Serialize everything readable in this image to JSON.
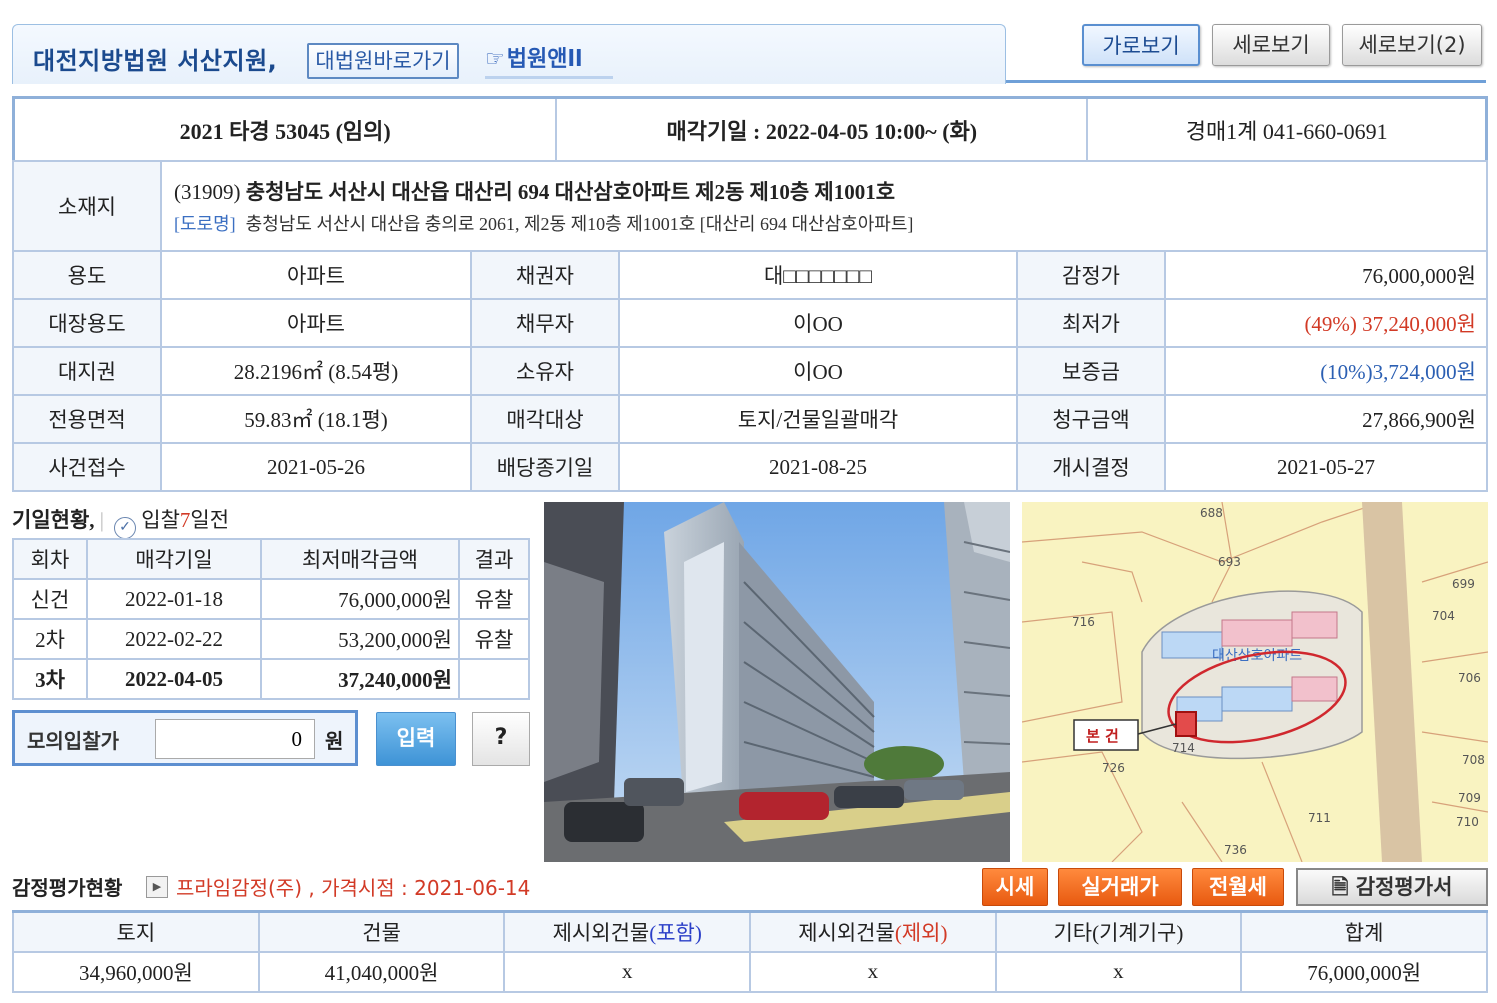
{
  "header": {
    "court_name": "대전지방법원 서산지원,",
    "court_link": "대법원바로가기",
    "court_ani": "법원앤ll",
    "view_landscape": "가로보기",
    "view_portrait": "세로보기",
    "view_portrait2": "세로보기(2)"
  },
  "case": {
    "number": "2021 타경 53045 (임의)",
    "sale_date": "매각기일 : 2022-04-05 10:00~ (화)",
    "dept": "경매1계 041-660-0691"
  },
  "address": {
    "label": "소재지",
    "zip": "(31909)",
    "main": "충청남도 서산시 대산읍 대산리 694 대산삼호아파트 제2동 제10층 제1001호",
    "road_tag": "[도로명]",
    "road": "충청남도 서산시 대산읍 충의로 2061, 제2동 제10층 제1001호 [대산리 694 대산삼호아파트]"
  },
  "info": {
    "use_label": "용도",
    "use": "아파트",
    "creditor_label": "채권자",
    "creditor": "대□□□□□□□",
    "appraisal_label": "감정가",
    "appraisal": "76,000,000원",
    "ledger_label": "대장용도",
    "ledger": "아파트",
    "debtor_label": "채무자",
    "debtor": "이OO",
    "min_label": "최저가",
    "min_price": "(49%) 37,240,000원",
    "land_label": "대지권",
    "land": "28.2196㎡ (8.54평)",
    "owner_label": "소유자",
    "owner": "이OO",
    "deposit_label": "보증금",
    "deposit": "(10%)3,724,000원",
    "area_label": "전용면적",
    "area": "59.83㎡ (18.1평)",
    "target_label": "매각대상",
    "target": "토지/건물일괄매각",
    "claim_label": "청구금액",
    "claim": "27,866,900원",
    "received_label": "사건접수",
    "received": "2021-05-26",
    "dividend_label": "배당종기일",
    "dividend": "2021-08-25",
    "start_label": "개시결정",
    "start": "2021-05-27"
  },
  "schedule": {
    "title": "기일현황,",
    "bid_prefix": "입찰",
    "bid_days": "7",
    "bid_suffix": "일전",
    "headers": [
      "회차",
      "매각기일",
      "최저매각금액",
      "결과"
    ],
    "rows": [
      [
        "신건",
        "2022-01-18",
        "76,000,000원",
        "유찰"
      ],
      [
        "2차",
        "2022-02-22",
        "53,200,000원",
        "유찰"
      ],
      [
        "3차",
        "2022-04-05",
        "37,240,000원",
        ""
      ]
    ]
  },
  "mock": {
    "label": "모의입찰가",
    "value": "0",
    "unit": "원",
    "submit": "입력",
    "help": "?"
  },
  "map": {
    "target_label": "본 건",
    "apt_name": "대산삼호아파트",
    "labels": [
      "688",
      "693",
      "716",
      "714",
      "726",
      "711",
      "736",
      "699",
      "704",
      "706",
      "708",
      "709",
      "710"
    ]
  },
  "appraisal": {
    "title": "감정평가현황",
    "info": "프라임감정(주) , 가격시점 : 2021-06-14",
    "btn_market": "시세",
    "btn_real": "실거래가",
    "btn_rent": "전월세",
    "btn_report": "감정평가서",
    "headers": [
      "토지",
      "건물",
      "제시외건물",
      "제시외건물",
      "기타(기계기구)",
      "합계"
    ],
    "header_suffix_in": "(포함)",
    "header_suffix_out": "(제외)",
    "values": [
      "34,960,000원",
      "41,040,000원",
      "x",
      "x",
      "x",
      "76,000,000원"
    ]
  }
}
